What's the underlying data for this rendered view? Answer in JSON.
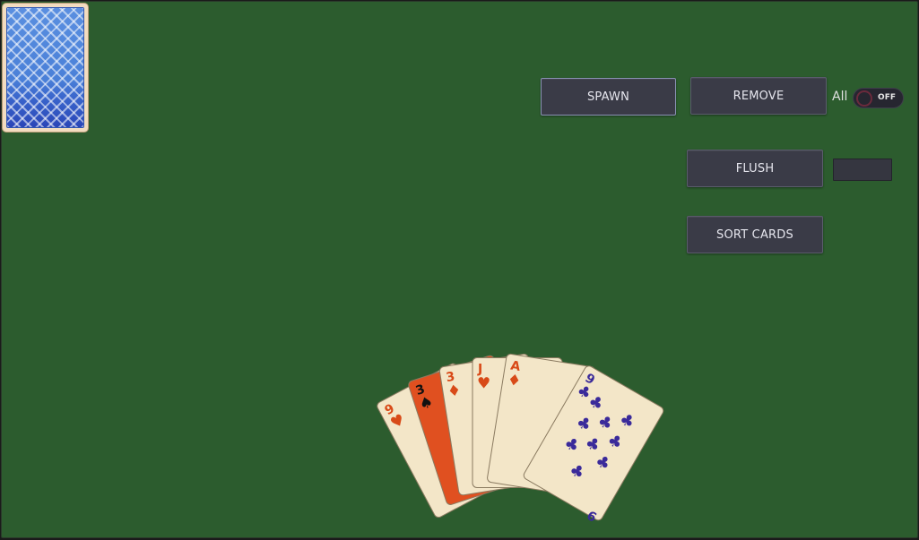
{
  "deck": {
    "icon": "card-back-icon"
  },
  "controls": {
    "spawn_label": "SPAWN",
    "remove_label": "REMOVE",
    "all_label": "All",
    "toggle_state": "OFF",
    "flush_label": "FLUSH",
    "flush_value": "",
    "sort_label": "SORT CARDS"
  },
  "hand": {
    "cards": [
      {
        "rank": "9",
        "suit": "hearts",
        "symbol": "♥",
        "color": "#d84a18",
        "face": "up"
      },
      {
        "rank": "3",
        "suit": "spades",
        "symbol": "♠",
        "color": "#111111",
        "face": "up",
        "highlight": true
      },
      {
        "rank": "3",
        "suit": "diamonds",
        "symbol": "♦",
        "color": "#d84a18",
        "face": "up"
      },
      {
        "rank": "J",
        "suit": "hearts",
        "symbol": "♥",
        "color": "#d84a18",
        "face": "up"
      },
      {
        "rank": "A",
        "suit": "diamonds",
        "symbol": "♦",
        "color": "#d84a18",
        "face": "up"
      },
      {
        "rank": "9",
        "suit": "clubs",
        "symbol": "♣",
        "color": "#3a2a9a",
        "face": "up"
      }
    ]
  },
  "colors": {
    "table": "#2c5c2e",
    "button": "#3a3b47",
    "card_face": "#f3e6c8",
    "highlight_card": "#e05020"
  }
}
